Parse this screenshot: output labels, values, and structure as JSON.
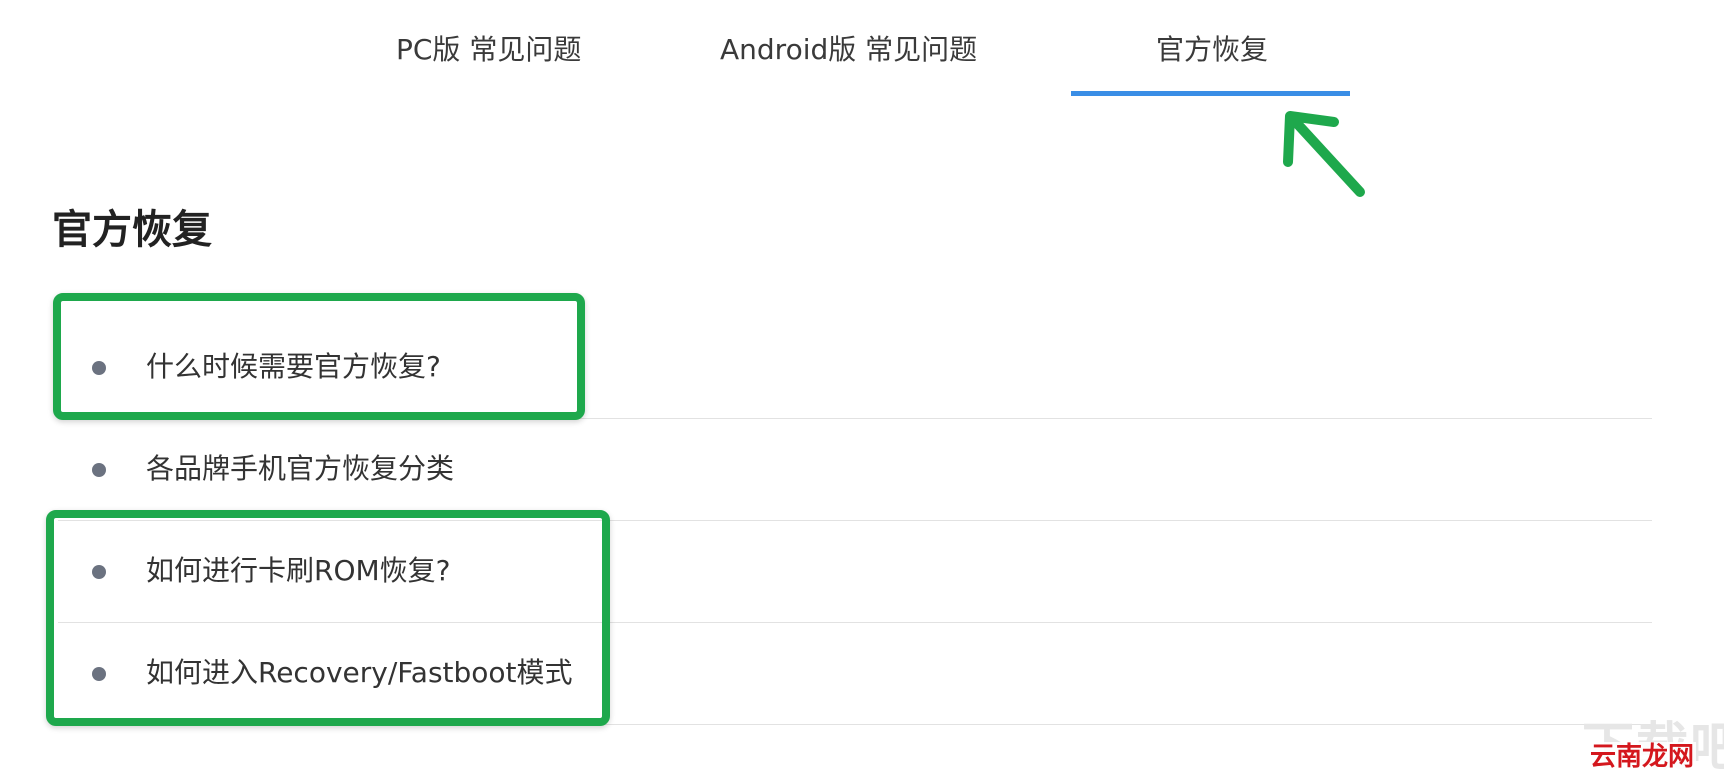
{
  "tabs": [
    {
      "label": "PC版 常见问题"
    },
    {
      "label": "Android版 常见问题"
    },
    {
      "label": "官方恢复",
      "active": true
    }
  ],
  "section": {
    "title": "官方恢复"
  },
  "faq": [
    {
      "label": "什么时候需要官方恢复?"
    },
    {
      "label": "各品牌手机官方恢复分类"
    },
    {
      "label": "如何进行卡刷ROM恢复?"
    },
    {
      "label": "如何进入Recovery/Fastboot模式"
    }
  ],
  "watermark": {
    "background_text": "下载吧",
    "text": "云南龙网"
  },
  "colors": {
    "accent": "#3a8ee6",
    "highlight": "#1ea84c",
    "bullet": "#6b7280",
    "watermark": "#d4171d"
  }
}
